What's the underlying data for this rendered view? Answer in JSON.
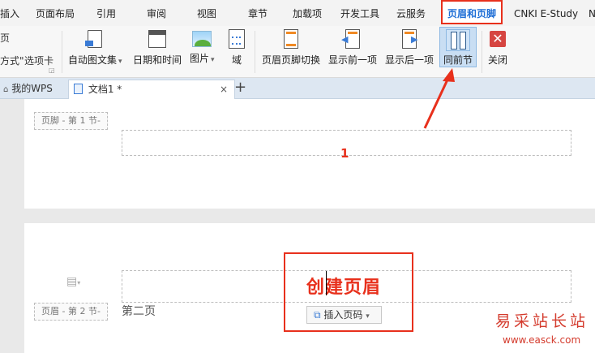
{
  "ribbon_tabs": [
    {
      "label": "插入"
    },
    {
      "label": "页面布局"
    },
    {
      "label": "引用"
    },
    {
      "label": "审阅"
    },
    {
      "label": "视图"
    },
    {
      "label": "章节"
    },
    {
      "label": "加载项"
    },
    {
      "label": "开发工具"
    },
    {
      "label": "云服务"
    },
    {
      "label": "页眉和页脚"
    },
    {
      "label": "CNKI E-Study"
    },
    {
      "label": "N"
    }
  ],
  "ribbon": {
    "left_top_label": "页",
    "left_format_label": "方式\"",
    "options_label": "选项卡",
    "auto_text": "自动图文集",
    "date_time": "日期和时间",
    "picture": "图片",
    "field": "域",
    "switch_header_footer": "页眉页脚切换",
    "show_prev": "显示前一项",
    "show_next": "显示后一项",
    "same_as_prev": "同前节",
    "close": "关闭"
  },
  "doc_tabs": {
    "my_wps": "我的WPS",
    "doc1": "文档1 *",
    "close_glyph": "×",
    "new_glyph": "+"
  },
  "page1": {
    "footer_tag": "页脚 - 第 1 节-",
    "annotation_number": "1"
  },
  "page2": {
    "header_text": "创建页眉",
    "insert_page_number": "插入页码",
    "header_tag": "页眉 - 第 2 节-",
    "section_text": "第二页"
  },
  "watermark": {
    "title": "易采站长站",
    "url": "www.easck.com"
  },
  "colors": {
    "highlight_red": "#e8301c",
    "active_tab_blue": "#1f6fd6"
  }
}
